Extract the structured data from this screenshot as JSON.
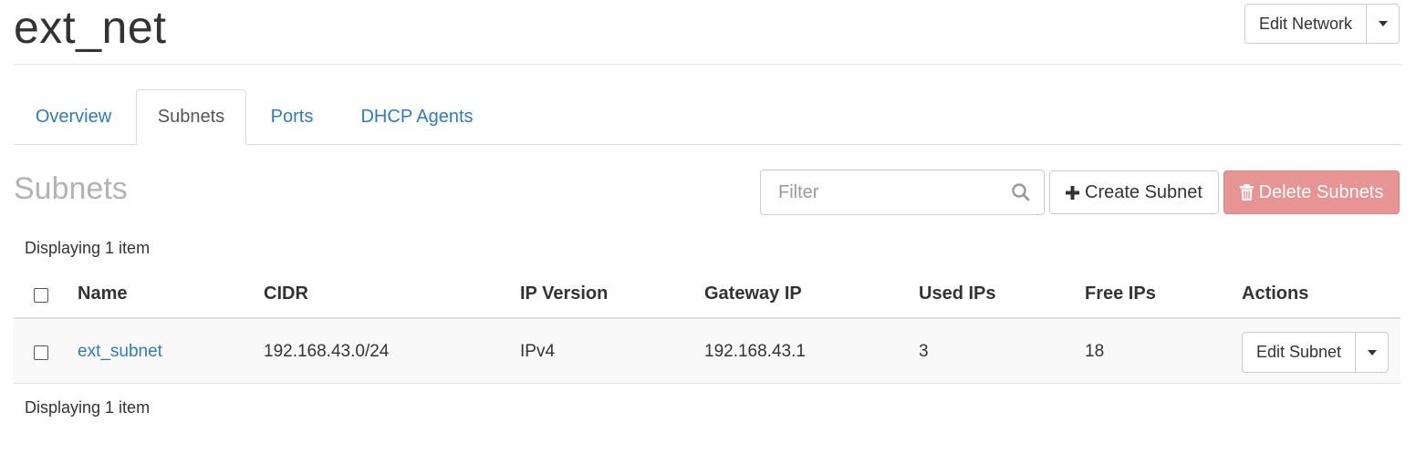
{
  "header": {
    "title": "ext_net",
    "edit_network_label": "Edit Network"
  },
  "tabs": [
    {
      "label": "Overview",
      "active": false
    },
    {
      "label": "Subnets",
      "active": true
    },
    {
      "label": "Ports",
      "active": false
    },
    {
      "label": "DHCP Agents",
      "active": false
    }
  ],
  "section": {
    "title": "Subnets",
    "filter_placeholder": "Filter",
    "filter_value": "",
    "create_label": "Create Subnet",
    "delete_label": "Delete Subnets",
    "display_count": "Displaying 1 item"
  },
  "table": {
    "columns": [
      "Name",
      "CIDR",
      "IP Version",
      "Gateway IP",
      "Used IPs",
      "Free IPs",
      "Actions"
    ],
    "rows": [
      {
        "name": "ext_subnet",
        "cidr": "192.168.43.0/24",
        "ip_version": "IPv4",
        "gateway_ip": "192.168.43.1",
        "used_ips": "3",
        "free_ips": "18",
        "action_label": "Edit Subnet"
      }
    ]
  },
  "colors": {
    "link": "#337ab7",
    "danger_disabled": "#e69494",
    "muted_title": "#b3b3b3"
  },
  "icons": {
    "search": "search-icon",
    "plus": "plus-icon",
    "trash": "trash-icon",
    "caret": "caret-down-icon"
  }
}
